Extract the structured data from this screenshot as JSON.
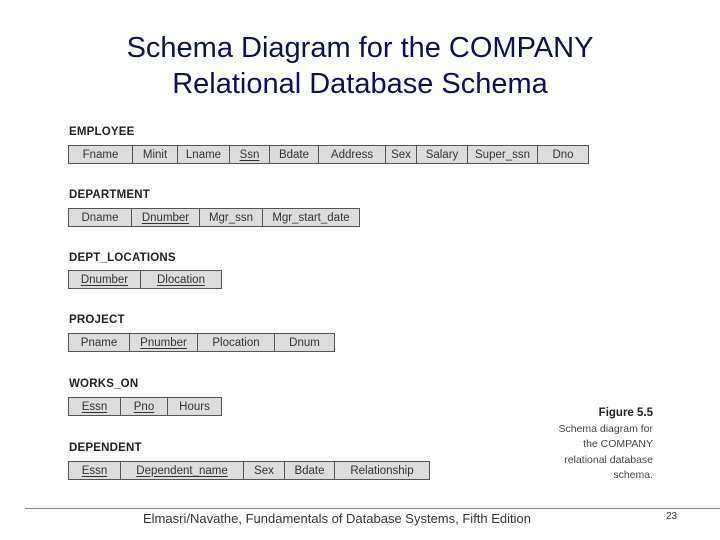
{
  "title": {
    "line1": "Schema Diagram for the COMPANY",
    "line2": "Relational Database Schema"
  },
  "relations": {
    "employee": {
      "name": "EMPLOYEE",
      "attributes": [
        {
          "label": "Fname",
          "pk": false
        },
        {
          "label": "Minit",
          "pk": false
        },
        {
          "label": "Lname",
          "pk": false
        },
        {
          "label": "Ssn",
          "pk": true
        },
        {
          "label": "Bdate",
          "pk": false
        },
        {
          "label": "Address",
          "pk": false
        },
        {
          "label": "Sex",
          "pk": false
        },
        {
          "label": "Salary",
          "pk": false
        },
        {
          "label": "Super_ssn",
          "pk": false
        },
        {
          "label": "Dno",
          "pk": false
        }
      ]
    },
    "department": {
      "name": "DEPARTMENT",
      "attributes": [
        {
          "label": "Dname",
          "pk": false
        },
        {
          "label": "Dnumber",
          "pk": true
        },
        {
          "label": "Mgr_ssn",
          "pk": false
        },
        {
          "label": "Mgr_start_date",
          "pk": false
        }
      ]
    },
    "dept_locations": {
      "name": "DEPT_LOCATIONS",
      "attributes": [
        {
          "label": "Dnumber",
          "pk": true
        },
        {
          "label": "Dlocation",
          "pk": true
        }
      ]
    },
    "project": {
      "name": "PROJECT",
      "attributes": [
        {
          "label": "Pname",
          "pk": false
        },
        {
          "label": "Pnumber",
          "pk": true
        },
        {
          "label": "Plocation",
          "pk": false
        },
        {
          "label": "Dnum",
          "pk": false
        }
      ]
    },
    "works_on": {
      "name": "WORKS_ON",
      "attributes": [
        {
          "label": "Essn",
          "pk": true
        },
        {
          "label": "Pno",
          "pk": true
        },
        {
          "label": "Hours",
          "pk": false
        }
      ]
    },
    "dependent": {
      "name": "DEPENDENT",
      "attributes": [
        {
          "label": "Essn",
          "pk": true
        },
        {
          "label": "Dependent_name",
          "pk": true
        },
        {
          "label": "Sex",
          "pk": false
        },
        {
          "label": "Bdate",
          "pk": false
        },
        {
          "label": "Relationship",
          "pk": false
        }
      ]
    }
  },
  "caption": {
    "figure": "Figure 5.5",
    "lines": [
      "Schema diagram for",
      "the COMPANY",
      "relational database",
      "schema."
    ]
  },
  "footer": {
    "text": "Elmasri/Navathe, Fundamentals of Database Systems, Fifth Edition",
    "page_number": "23"
  }
}
